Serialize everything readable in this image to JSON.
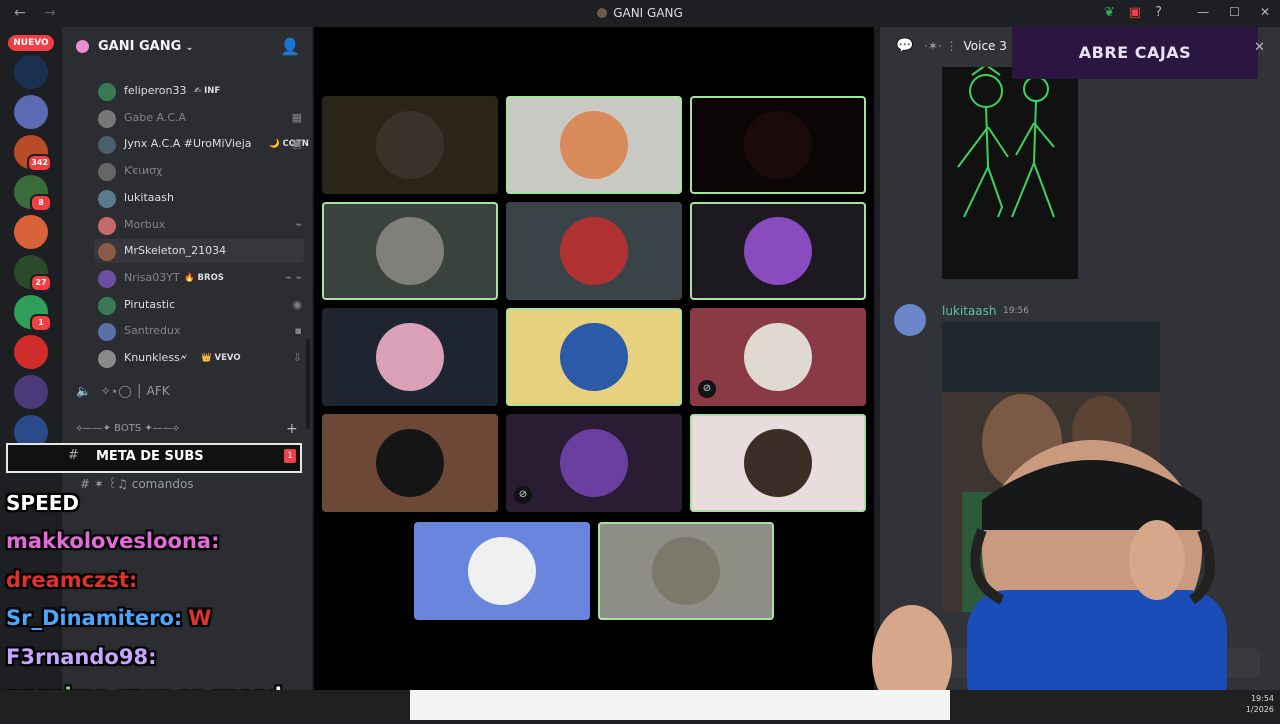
{
  "titlebar": {
    "title": "GANI GANG"
  },
  "rail": {
    "new_badge": "NUEVO",
    "servers": [
      {
        "badge": ""
      },
      {
        "badge": ""
      },
      {
        "badge": "342"
      },
      {
        "badge": "8"
      },
      {
        "badge": ""
      },
      {
        "badge": "27"
      },
      {
        "badge": "1"
      },
      {
        "badge": ""
      },
      {
        "badge": ""
      },
      {
        "badge": ""
      }
    ]
  },
  "sidebar": {
    "guild_name": "GANI GANG",
    "members": [
      {
        "name": "feliperon33",
        "tag": "✍ INF",
        "muted": false
      },
      {
        "name": "Gabe A.C.A",
        "tag": "",
        "muted": true
      },
      {
        "name": "Jynx A.C.A #UroMiVieja",
        "tag": "🌙 COTN",
        "muted": false
      },
      {
        "name": "Ƙєιиσχ",
        "tag": "",
        "muted": true
      },
      {
        "name": "lukitaash",
        "tag": "",
        "muted": false
      },
      {
        "name": "Morbux",
        "tag": "",
        "muted": true
      },
      {
        "name": "MrSkeleton_21034",
        "tag": "",
        "muted": false
      },
      {
        "name": "Nrisa03YT",
        "tag": "🔥 BROS",
        "muted": true
      },
      {
        "name": "Pirutastic",
        "tag": "",
        "muted": false
      },
      {
        "name": "Santredux",
        "tag": "",
        "muted": true
      },
      {
        "name": "Knunkless🗲",
        "tag": "👑 VEVO",
        "muted": false
      }
    ],
    "afk_channel": "AFK",
    "bots_category": "⟡——✦ BOTS ✦——⟡",
    "channel_comandos": "comandos"
  },
  "stream": {
    "meta_label": "META DE SUBS",
    "badge": "1",
    "speed_label": "SPEED",
    "chat": [
      {
        "user": "makkolovesloona:",
        "user_color": "#e46ad9",
        "text": ""
      },
      {
        "user": "dreamczst:",
        "user_color": "#e0322c",
        "text": ""
      },
      {
        "user": "Sr_Dinamitero:",
        "user_color": "#4aa5ff",
        "text": "W"
      },
      {
        "user": "F3rnando98:",
        "user_color": "#c7a4ff",
        "text": ""
      },
      {
        "user": "anonimo_raw:",
        "user_color": "#7ee06b",
        "text": "es speed"
      }
    ]
  },
  "tiles": [
    {
      "bg": "#2b2418",
      "pic": "#3a3128",
      "speaking": false,
      "muted": false
    },
    {
      "bg": "#c9c9c4",
      "pic": "#d98a5a",
      "speaking": true,
      "muted": false
    },
    {
      "bg": "#0c0505",
      "pic": "#1a0b0b",
      "speaking": true,
      "muted": false
    },
    {
      "bg": "#39423c",
      "pic": "#7f8079",
      "speaking": true,
      "muted": false
    },
    {
      "bg": "#3a4448",
      "pic": "#b03131",
      "speaking": false,
      "muted": false
    },
    {
      "bg": "#1c1a20",
      "pic": "#8a4ac0",
      "speaking": true,
      "muted": false
    },
    {
      "bg": "#1e2530",
      "pic": "#d9a0b8",
      "speaking": false,
      "muted": false
    },
    {
      "bg": "#e7d07e",
      "pic": "#2a5aa8",
      "speaking": true,
      "muted": false
    },
    {
      "bg": "#8a3a45",
      "pic": "#e0d9d2",
      "speaking": false,
      "muted": true
    },
    {
      "bg": "#6d4836",
      "pic": "#151515",
      "speaking": false,
      "muted": false
    },
    {
      "bg": "#2a1d33",
      "pic": "#6a3fa0",
      "speaking": false,
      "muted": true
    },
    {
      "bg": "#e8dcdc",
      "pic": "#3a2e26",
      "speaking": true,
      "muted": false
    },
    {
      "bg": "#6985dd",
      "pic": "#f0f0f0",
      "speaking": false,
      "muted": false
    },
    {
      "bg": "#8e8e87",
      "pic": "#7b786c",
      "speaking": true,
      "muted": false
    }
  ],
  "chat_panel": {
    "channel_name": "Voice 3",
    "overlay_banner": "ABRE CAJAS",
    "message": {
      "author": "lukitaash",
      "time": "19:56"
    }
  },
  "taskbar": {
    "time": "19:54",
    "date": "1/2026"
  }
}
